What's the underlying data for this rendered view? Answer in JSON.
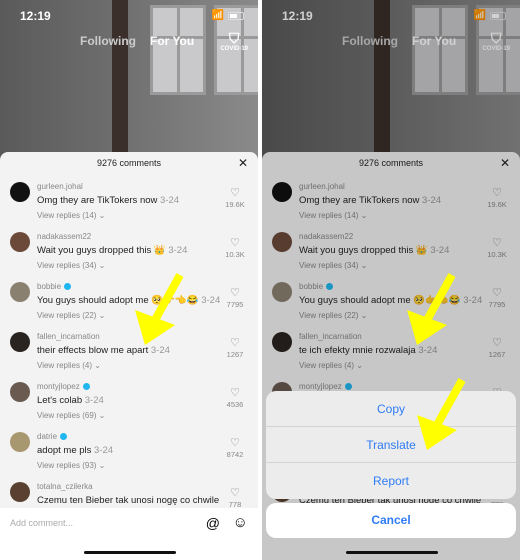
{
  "status": {
    "time": "12:19"
  },
  "nav": {
    "following": "Following",
    "for_you": "For You",
    "covid": "COVID-19"
  },
  "sheet": {
    "title": "9276 comments",
    "add_placeholder": "Add comment..."
  },
  "comments": [
    {
      "user": "gurleen.johal",
      "verified": false,
      "text": "Omg they are TikTokers now",
      "date": "3-24",
      "replies": "View replies (14)",
      "likes": "19.6K",
      "avatar": "#111111"
    },
    {
      "user": "nadakassem22",
      "verified": false,
      "text": "Wait you guys dropped this 👑",
      "date": "3-24",
      "replies": "View replies (34)",
      "likes": "10.3K",
      "avatar": "#6b4a3a"
    },
    {
      "user": "bobbie",
      "verified": true,
      "text": "You guys should adopt me 🥺👉👈😂",
      "date": "3-24",
      "replies": "View replies (22)",
      "likes": "7795",
      "avatar": "#8a8070"
    },
    {
      "user": "fallen_incarnation",
      "verified": false,
      "text": "their effects blow me apart",
      "translated": "te ich efekty mnie rozwalaja",
      "date": "3-24",
      "replies": "View replies (4)",
      "likes": "1267",
      "avatar": "#2a2420"
    },
    {
      "user": "montyjlopez",
      "verified": true,
      "text": "Let's colab",
      "date": "3-24",
      "replies": "View replies (69)",
      "likes": "4536",
      "avatar": "#6a5a50"
    },
    {
      "user": "datrie",
      "verified": true,
      "text": "adopt me pls",
      "date": "3-24",
      "replies": "View replies (93)",
      "likes": "8742",
      "avatar": "#a89870"
    },
    {
      "user": "totalna_czilerka",
      "verified": false,
      "text": "Czemu ten Bieber tak unosi nogę co chwile",
      "date": "",
      "replies": "",
      "likes": "778",
      "avatar": "#5a4030"
    }
  ],
  "action_sheet": {
    "items": [
      "Copy",
      "Translate",
      "Report"
    ],
    "cancel": "Cancel"
  },
  "colors": {
    "accent": "#2f7cf6",
    "verified": "#20b6f0",
    "annotation_arrow": "#ffff00"
  }
}
